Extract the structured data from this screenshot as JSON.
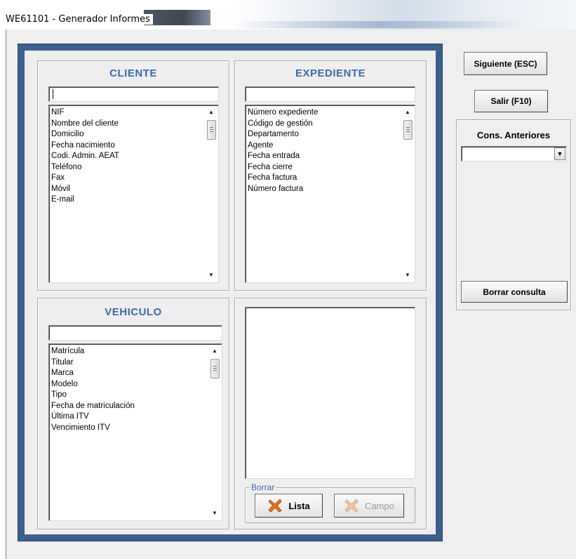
{
  "window": {
    "title": "WE61101 - Generador Informes"
  },
  "cliente": {
    "title": "CLIENTE",
    "search_value": "",
    "items": [
      "NIF",
      "Nombre del cliente",
      "Domicilio",
      "Fecha nacimiento",
      "Codi. Admin. AEAT",
      "Teléfono",
      "Fax",
      "Móvil",
      "E-mail"
    ]
  },
  "expediente": {
    "title": "EXPEDIENTE",
    "search_value": "",
    "items": [
      "Número expediente",
      "Código de gestión",
      "Departamento",
      "Agente",
      "Fecha entrada",
      "Fecha cierre",
      "Fecha factura",
      "Número factura"
    ]
  },
  "vehiculo": {
    "title": "VEHICULO",
    "search_value": "",
    "items": [
      "Matrícula",
      "Titular",
      "Marca",
      "Modelo",
      "Tipo",
      "Fecha de matriculación",
      "Última ITV",
      "Vencimiento ITV"
    ]
  },
  "borrar": {
    "legend": "Borrar",
    "lista_label": "Lista",
    "campo_label": "Campo"
  },
  "sidebar": {
    "siguiente_label": "Siguiente (ESC)",
    "salir_label": "Salir (F10)",
    "cons_title": "Cons. Anteriores",
    "cons_selected": "",
    "borrar_consulta_label": "Borrar consulta"
  },
  "icons": {
    "scroll_up": "▲",
    "scroll_down": "▼",
    "dropdown": "▼"
  },
  "colors": {
    "frame_blue": "#3d5f8c",
    "group_title": "#3d6aa8",
    "delete_icon": "#e8731e"
  }
}
